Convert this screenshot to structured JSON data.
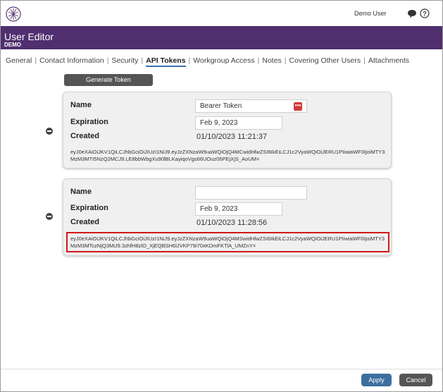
{
  "topbar": {
    "user_name": "Demo User",
    "logo_icon": "star-compass-logo-icon",
    "chat_icon": "chat-bubble-icon",
    "help_icon": "help-circle-icon"
  },
  "header": {
    "title": "User Editor",
    "subtitle": "DEMO",
    "color": "#4f2f6e"
  },
  "tabs": [
    {
      "label": "General"
    },
    {
      "label": "Contact Information"
    },
    {
      "label": "Security"
    },
    {
      "label": "API Tokens",
      "active": true
    },
    {
      "label": "Workgroup Access"
    },
    {
      "label": "Notes"
    },
    {
      "label": "Covering Other Users"
    },
    {
      "label": "Attachments"
    }
  ],
  "generate_button": "Generate Token",
  "tokens": [
    {
      "name_label": "Name",
      "name_value": "Bearer Token",
      "expiration_label": "Expiration",
      "expiration_value": "Feb 9, 2023",
      "created_label": "Created",
      "created_value": "01/10/2023 11:21:37",
      "token": "eyJ0eXAiOiJKV1QiLCJhbGciOiJIUzI1NiJ9.eyJzZXNzaW9uaWQiOjQ4MCwidHlwZSI6IkEiLCJ1c2VyaWQiOiJERU1PIiwiaWF0IjoiMTY3MzM3MTI5NzQ2MCJ9.LE8bbWbgXu90lBLKayiqoVgs66UOuz06PEjXjS_AoUM="
    },
    {
      "name_label": "Name",
      "name_value": "",
      "expiration_label": "Expiration",
      "expiration_value": "Feb 9, 2023",
      "created_label": "Created",
      "created_value": "01/10/2023 11:28:56",
      "token": "eyJ0eXAiOiJKV1QiLCJhbGciOiJIUzI1NiJ9.eyJzZXNzaW9uaWQiOjQ4MSwidHlwZSI6IkEiLCJ1c2VyaWQiOiJERU1PIiwiaWF0IjoiMTY3MzM3MTczNjQ3MiJ9.3zhfH8zlO_XjEQBSH6lJVKP79i70xKDmFKTlA_UMZnY="
    }
  ],
  "footer": {
    "apply": "Apply",
    "cancel": "Cancel"
  },
  "colors": {
    "highlight": "#d11818",
    "apply": "#3d6f9e"
  }
}
